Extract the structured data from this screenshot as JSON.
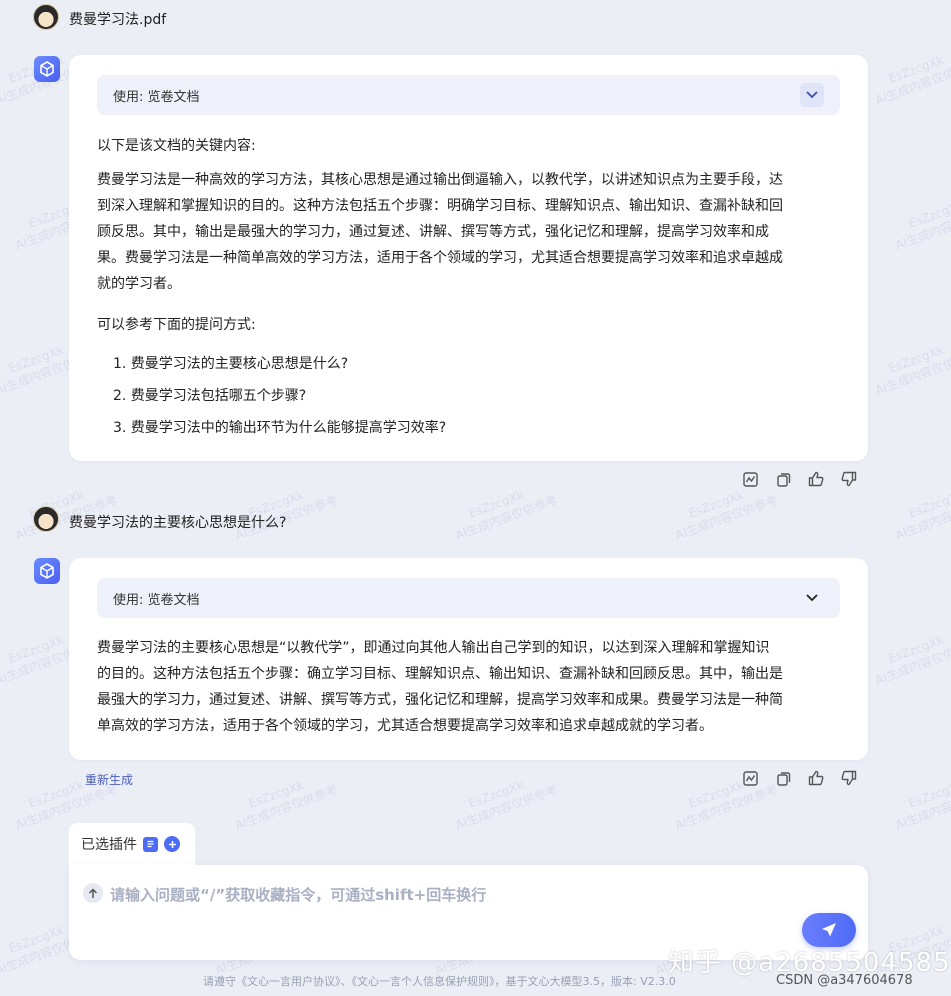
{
  "messages": {
    "user1": {
      "text": "费曼学习法.pdf"
    },
    "bot1": {
      "plugin_label": "使用: 览卷文档",
      "intro": "以下是该文档的关键内容:",
      "paragraph_lines": [
        "费曼学习法是一种高效的学习方法，其核心思想是通过输出倒逼输入，以教代学，以讲述知识点为主要手段，达",
        "到深入理解和掌握知识的目的。这种方法包括五个步骤：明确学习目标、理解知识点、输出知识、查漏补缺和回",
        "顾反思。其中，输出是最强大的学习力，通过复述、讲解、撰写等方式，强化记忆和理解，提高学习效率和成",
        "果。费曼学习法是一种简单高效的学习方法，适用于各个领域的学习，尤其适合想要提高学习效率和追求卓越成",
        "就的学习者。"
      ],
      "suggest_title": "可以参考下面的提问方式:",
      "questions": [
        "1. 费曼学习法的主要核心思想是什么?",
        "2. 费曼学习法包括哪五个步骤?",
        "3. 费曼学习法中的输出环节为什么能够提高学习效率?"
      ]
    },
    "user2": {
      "text": "费曼学习法的主要核心思想是什么?"
    },
    "bot2": {
      "plugin_label": "使用: 览卷文档",
      "paragraph_lines": [
        "费曼学习法的主要核心思想是“以教代学”，即通过向其他人输出自己学到的知识，以达到深入理解和掌握知识",
        "的目的。这种方法包括五个步骤：确立学习目标、理解知识点、输出知识、查漏补缺和回顾反思。其中，输出是",
        "最强大的学习力，通过复述、讲解、撰写等方式，强化记忆和理解，提高学习效率和成果。费曼学习法是一种简",
        "单高效的学习方法，适用于各个领域的学习，尤其适合想要提高学习效率和追求卓越成就的学习者。"
      ],
      "regenerate_label": "重新生成"
    }
  },
  "composer": {
    "plugins_label": "已选插件",
    "placeholder": "请输入问题或“/”获取收藏指令，可通过shift+回车换行"
  },
  "footer": {
    "text": "请遵守《文心一言用户协议》、《文心一言个人信息保护规则》，基于文心大模型3.5，版本: V2.3.0"
  },
  "watermarks": {
    "zhihu": "知乎 @a2685504585",
    "csdn": "CSDN @a347604678",
    "tile_line1": "EsZzcgXk",
    "tile_line2": "AI生成内容仅供参考"
  },
  "colors": {
    "background": "#eceef6",
    "accent": "#4e6bf5",
    "plugin_bar": "#eef0fa"
  },
  "icons": {
    "bot": "bot-cube-icon",
    "chevron": "chevron-down-icon",
    "actions": [
      "chart-icon",
      "copy-icon",
      "thumbs-up-icon",
      "thumbs-down-icon"
    ],
    "upload": "upload-icon",
    "send": "send-icon"
  }
}
